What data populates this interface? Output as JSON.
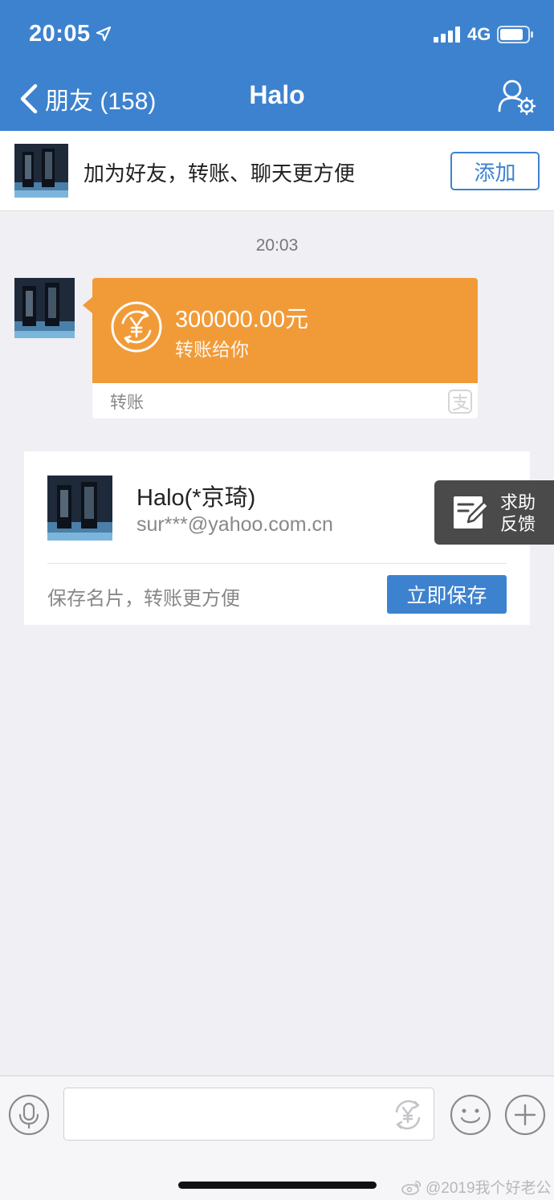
{
  "status_bar": {
    "time": "20:05",
    "network": "4G"
  },
  "nav": {
    "back_label": "朋友 (158)",
    "title": "Halo"
  },
  "add_banner": {
    "text": "加为好友，转账、聊天更方便",
    "button": "添加"
  },
  "chat": {
    "timestamp": "20:03",
    "transfer": {
      "amount": "300000.00元",
      "subtitle": "转账给你",
      "footer_label": "转账",
      "accent_color": "#f19b38"
    }
  },
  "contact_card": {
    "name": "Halo(*京琦)",
    "email": "sur***@yahoo.com.cn",
    "hint": "保存名片，转账更方便",
    "save_button": "立即保存"
  },
  "help_float": {
    "line1": "求助",
    "line2": "反馈"
  },
  "input_bar": {
    "placeholder": ""
  },
  "watermark": {
    "text": "@2019我个好老公"
  },
  "colors": {
    "primary": "#3d82cf",
    "transfer_orange": "#f19b38",
    "background": "#efeff4"
  }
}
